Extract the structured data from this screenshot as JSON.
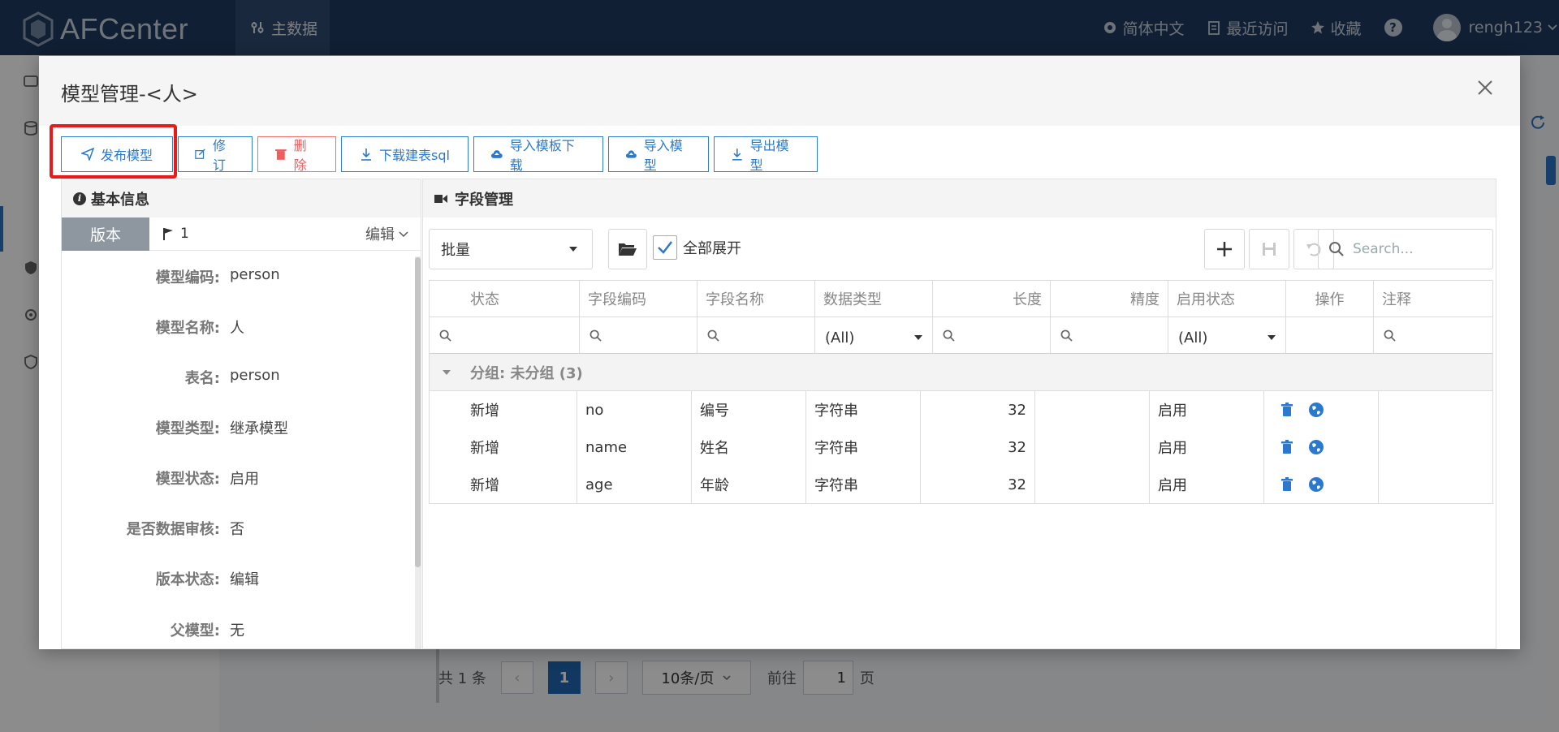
{
  "app": {
    "logo_text": "AFCenter",
    "nav_tab": "主数据",
    "language": "简体中文",
    "recent": "最近访问",
    "favorites": "收藏",
    "help": "?",
    "username": "rengh123"
  },
  "pager": {
    "total": "共 1 条",
    "prev": "‹",
    "current": "1",
    "next": "›",
    "page_size": "10条/页",
    "goto_label": "前往",
    "goto_value": "1",
    "page_suffix": "页"
  },
  "modal": {
    "title": "模型管理-<人>",
    "toolbar": {
      "publish": "发布模型",
      "revise": "修订",
      "delete": "删除",
      "download_sql": "下载建表sql",
      "template_download": "导入模板下载",
      "import_model": "导入模型",
      "export_model": "导出模型"
    },
    "basic_info": {
      "header": "基本信息",
      "version_tab": "版本",
      "version_number": "1",
      "version_edit": "编辑",
      "props": [
        {
          "label": "模型编码:",
          "value": "person"
        },
        {
          "label": "模型名称:",
          "value": "人"
        },
        {
          "label": "表名:",
          "value": "person"
        },
        {
          "label": "模型类型:",
          "value": "继承模型"
        },
        {
          "label": "模型状态:",
          "value": "启用"
        },
        {
          "label": "是否数据审核:",
          "value": "否"
        },
        {
          "label": "版本状态:",
          "value": "编辑"
        },
        {
          "label": "父模型:",
          "value": "无"
        }
      ]
    },
    "fields": {
      "header": "字段管理",
      "batch_label": "批量",
      "expand_all": "全部展开",
      "search_placeholder": "Search...",
      "columns": [
        "状态",
        "字段编码",
        "字段名称",
        "数据类型",
        "长度",
        "精度",
        "启用状态",
        "操作",
        "注释"
      ],
      "filter_all": "(All)",
      "group_label": "分组: 未分组 (3)",
      "rows": [
        {
          "status": "新增",
          "code": "no",
          "name": "编号",
          "type": "字符串",
          "length": "32",
          "precision": "",
          "enabled": "启用",
          "note": ""
        },
        {
          "status": "新增",
          "code": "name",
          "name": "姓名",
          "type": "字符串",
          "length": "32",
          "precision": "",
          "enabled": "启用",
          "note": ""
        },
        {
          "status": "新增",
          "code": "age",
          "name": "年龄",
          "type": "字符串",
          "length": "32",
          "precision": "",
          "enabled": "启用",
          "note": ""
        }
      ]
    }
  },
  "colors": {
    "topbar": "#1f3a5f",
    "accent": "#2f7fd1",
    "danger": "#ef5d5d",
    "highlight": "#e81b1b"
  }
}
